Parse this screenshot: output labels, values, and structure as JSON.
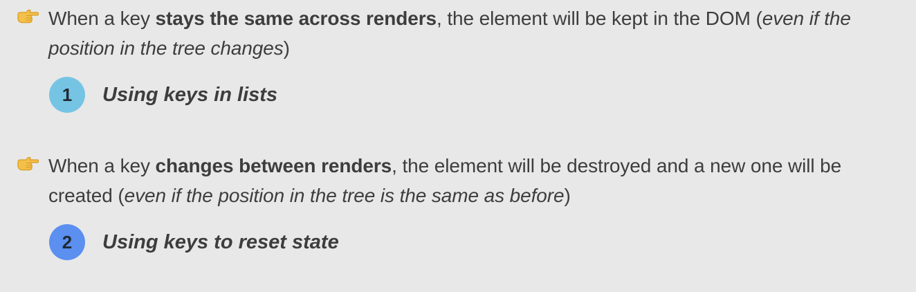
{
  "points": [
    {
      "icon": "pointing-hand-icon",
      "text": {
        "before": "When a key ",
        "bold": "stays the same across renders",
        "after": ", the element will be kept in the DOM (",
        "italic": "even if the position in the tree changes",
        "end": ")"
      },
      "sub": {
        "number": "1",
        "label": "Using keys in lists",
        "badge_color": "#76c4e4"
      }
    },
    {
      "icon": "pointing-hand-icon",
      "text": {
        "before": "When a key ",
        "bold": "changes between renders",
        "after": ", the element will be destroyed and a new one will be created (",
        "italic": "even if the position in the tree is the same as before",
        "end": ")"
      },
      "sub": {
        "number": "2",
        "label": "Using keys to reset state",
        "badge_color": "#5b8ff0"
      }
    }
  ]
}
